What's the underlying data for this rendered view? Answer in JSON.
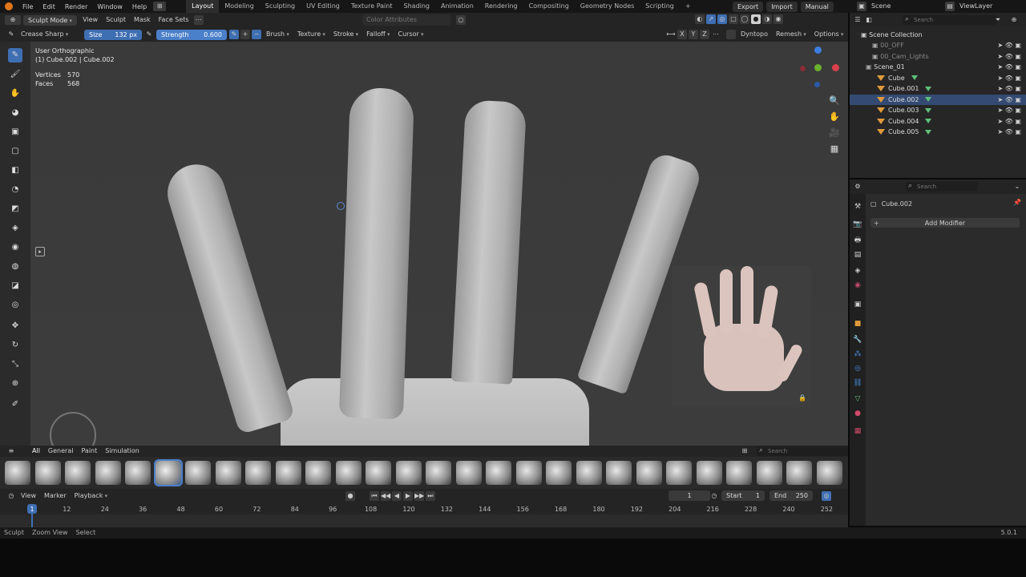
{
  "menu": {
    "items": [
      "File",
      "Edit",
      "Render",
      "Window",
      "Help"
    ],
    "workspaces": [
      "Layout",
      "Modeling",
      "Sculpting",
      "UV Editing",
      "Texture Paint",
      "Shading",
      "Animation",
      "Rendering",
      "Compositing",
      "Geometry Nodes",
      "Scripting"
    ],
    "active_workspace": "Layout",
    "add_tab": "+",
    "export": "Export",
    "import": "Import",
    "manual": "Manual",
    "scene": "Scene",
    "view_layer": "ViewLayer"
  },
  "header": {
    "mode": "Sculpt Mode",
    "view": "View",
    "sculpt": "Sculpt",
    "mask": "Mask",
    "face_sets": "Face Sets",
    "color_attributes": "Color Attributes"
  },
  "tool_settings": {
    "brush_name": "Crease Sharp",
    "size_label": "Size",
    "size_value": "132 px",
    "strength_label": "Strength",
    "strength_value": "0.600",
    "brush": "Brush",
    "texture": "Texture",
    "stroke": "Stroke",
    "falloff": "Falloff",
    "cursor": "Cursor",
    "axes": [
      "X",
      "Y",
      "Z"
    ],
    "dyntopo": "Dyntopo",
    "remesh": "Remesh",
    "options": "Options"
  },
  "viewport": {
    "view_name": "User Orthographic",
    "object_info": "(1) Cube.002 | Cube.002",
    "vertices_label": "Vertices",
    "vertices_value": "570",
    "faces_label": "Faces",
    "faces_value": "568"
  },
  "shelf": {
    "tabs": [
      "All",
      "General",
      "Paint",
      "Simulation"
    ],
    "active_tab": "All",
    "search_placeholder": "Search",
    "brush_count": 28,
    "selected_index": 5
  },
  "timeline": {
    "view": "View",
    "marker": "Marker",
    "playback": "Playback",
    "current_frame": "1",
    "start_label": "Start",
    "start_value": "1",
    "end_label": "End",
    "end_value": "250",
    "ticks": [
      "1",
      "12",
      "24",
      "36",
      "48",
      "60",
      "72",
      "84",
      "96",
      "108",
      "120",
      "132",
      "144",
      "156",
      "168",
      "180",
      "192",
      "204",
      "216",
      "228",
      "240",
      "252"
    ]
  },
  "status": {
    "items": [
      "Sculpt",
      "Zoom View",
      "Select"
    ],
    "version": "5.0.1"
  },
  "outliner": {
    "search_placeholder": "Search",
    "collection": "Scene Collection",
    "rows": [
      {
        "name": "00_OFF",
        "type": "collection"
      },
      {
        "name": "00_Cam_Lights",
        "type": "collection"
      },
      {
        "name": "Scene_01",
        "type": "collection"
      },
      {
        "name": "Cube",
        "type": "mesh"
      },
      {
        "name": "Cube.001",
        "type": "mesh"
      },
      {
        "name": "Cube.002",
        "type": "mesh",
        "selected": true
      },
      {
        "name": "Cube.003",
        "type": "mesh"
      },
      {
        "name": "Cube.004",
        "type": "mesh"
      },
      {
        "name": "Cube.005",
        "type": "mesh"
      }
    ]
  },
  "properties": {
    "search_placeholder": "Search",
    "object_name": "Cube.002",
    "add_modifier": "Add Modifier"
  },
  "colors": {
    "accent": "#3f6fb3",
    "mesh_icon": "#e09a3c",
    "modifier_icon": "#5fc07a",
    "logo": "#e0771c"
  }
}
